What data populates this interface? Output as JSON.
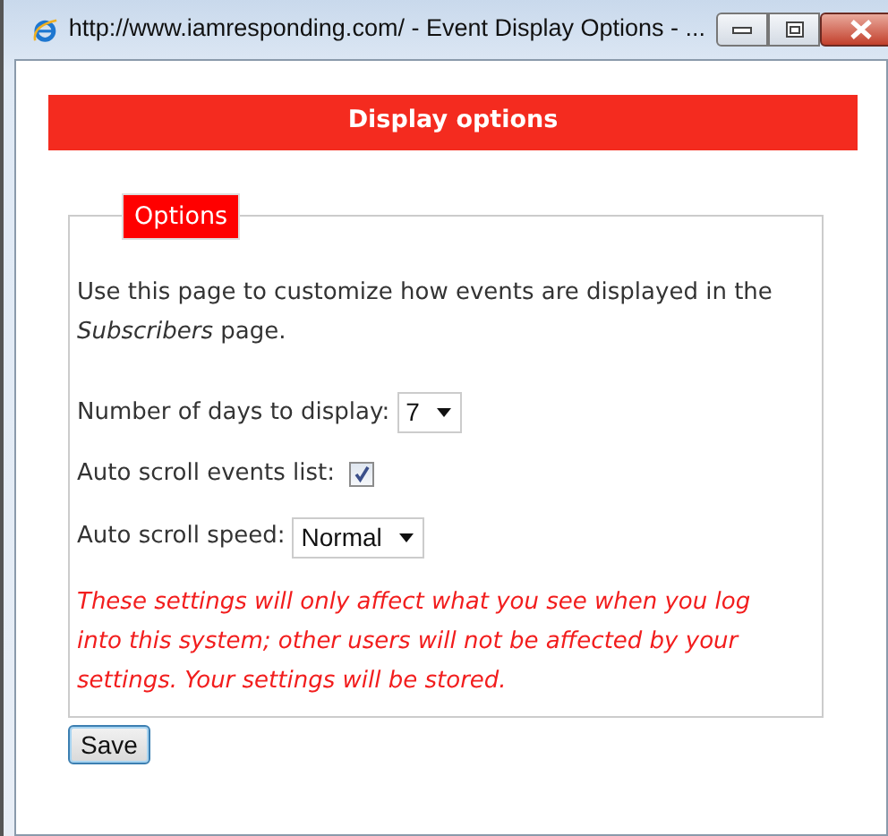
{
  "window": {
    "title": "http://www.iamresponding.com/ - Event Display Options - ..."
  },
  "header": {
    "title": "Display options"
  },
  "fieldset": {
    "legend": "Options"
  },
  "intro": "Use this page to customize how events are displayed in the *Subscribers* page.",
  "fields": [
    {
      "kind": "select",
      "label": "Number of days to display:",
      "value": "7"
    },
    {
      "kind": "checkbox",
      "label": "Auto scroll events list:",
      "checked": true
    },
    {
      "kind": "select",
      "label": "Auto scroll speed:",
      "value": "Normal"
    }
  ],
  "note": "These settings will only affect what you see when you log into this system; other users will not be affected by your settings. Your settings will be stored.",
  "buttons": [
    "Save"
  ]
}
